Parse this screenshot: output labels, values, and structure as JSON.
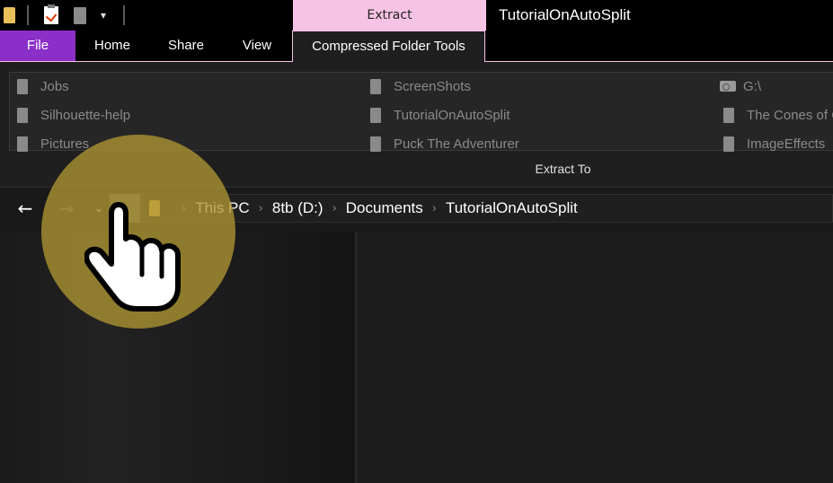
{
  "window": {
    "title": "TutorialOnAutoSplit",
    "context_tab": "Extract"
  },
  "quick_access": {
    "icons": [
      "folder-icon",
      "properties-icon",
      "new-folder-icon",
      "customize-dropdown-icon"
    ],
    "dropdown_glyph": "▾"
  },
  "ribbon": {
    "tabs": {
      "file": "File",
      "home": "Home",
      "share": "Share",
      "view": "View",
      "compressed": "Compressed Folder Tools"
    },
    "extract_to": {
      "destinations": [
        "Jobs",
        "ScreenShots",
        "G:\\",
        "Silhouette-help",
        "TutorialOnAutoSplit",
        "The Cones of C",
        "Pictures",
        "Puck The Adventurer",
        "ImageEffects"
      ],
      "group_label": "Extract To"
    }
  },
  "navigation": {
    "back_glyph": "←",
    "forward_glyph": "→",
    "recent_glyph": "⌄",
    "breadcrumb": [
      "This PC",
      "8tb (D:)",
      "Documents",
      "TutorialOnAutoSplit"
    ],
    "separator_glyph": "›"
  },
  "colors": {
    "file_tab": "#8b2fc9",
    "context_tab": "#f7c3e4",
    "folder": "#e8c05a",
    "cursor_halo": "#b09632"
  }
}
